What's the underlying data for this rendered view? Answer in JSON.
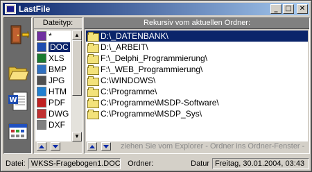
{
  "window": {
    "title": "LastFile"
  },
  "titlebar": {
    "minimize": "_",
    "maximize": "□",
    "close": "✕"
  },
  "iconstrip": [
    {
      "icon": "door-exit-icon",
      "color": "#c04020"
    },
    {
      "icon": "open-folder-icon",
      "color": "#f0d060"
    },
    {
      "icon": "word-document-icon",
      "color": "#1f4db0"
    },
    {
      "icon": "calendar-window-icon",
      "color": "#2050c0"
    }
  ],
  "filter_panel": {
    "header": "Dateityp:",
    "items": [
      {
        "label": "*",
        "icon": "all-files-icon",
        "color": "#7030a0"
      },
      {
        "label": "DOC",
        "icon": "doc-file-icon",
        "color": "#1f4db0",
        "selected": true
      },
      {
        "label": "XLS",
        "icon": "xls-file-icon",
        "color": "#1a7a30"
      },
      {
        "label": "BMP",
        "icon": "bmp-file-icon",
        "color": "#3070c0"
      },
      {
        "label": "JPG",
        "icon": "jpg-file-icon",
        "color": "#505050"
      },
      {
        "label": "HTM",
        "icon": "htm-file-icon",
        "color": "#2080d0"
      },
      {
        "label": "PDF",
        "icon": "pdf-file-icon",
        "color": "#c02020"
      },
      {
        "label": "DWG",
        "icon": "dwg-file-icon",
        "color": "#c03030"
      },
      {
        "label": "DXF",
        "icon": "dxf-file-icon",
        "color": "#808080"
      }
    ]
  },
  "folder_panel": {
    "header": "Rekursiv vom aktuellen Ordner:",
    "items": [
      {
        "path": "D:\\_DATENBANK\\",
        "selected": true
      },
      {
        "path": "D:\\_ARBEIT\\"
      },
      {
        "path": "F:\\_Delphi_Programmierung\\"
      },
      {
        "path": "F:\\_WEB_Programmierung\\"
      },
      {
        "path": "C:\\WINDOWS\\"
      },
      {
        "path": "C:\\Programme\\"
      },
      {
        "path": "C:\\Programme\\MSDP-Software\\"
      },
      {
        "path": "C:\\Programme\\MSDP_Sys\\"
      }
    ],
    "hint": "ziehen Sie vom Explorer - Ordner ins Ordner-Fenster -"
  },
  "statusbar": {
    "file_label": "Datei:",
    "file_value": "WKSS-Fragebogen1.DOC",
    "folder_label": "Ordner:",
    "date_label": "Datur",
    "date_value": "Freitag, 30.01.2004, 03:43"
  },
  "colors": {
    "selection": "#0a246a",
    "title_start": "#0a246a",
    "title_end": "#a6caf0"
  }
}
